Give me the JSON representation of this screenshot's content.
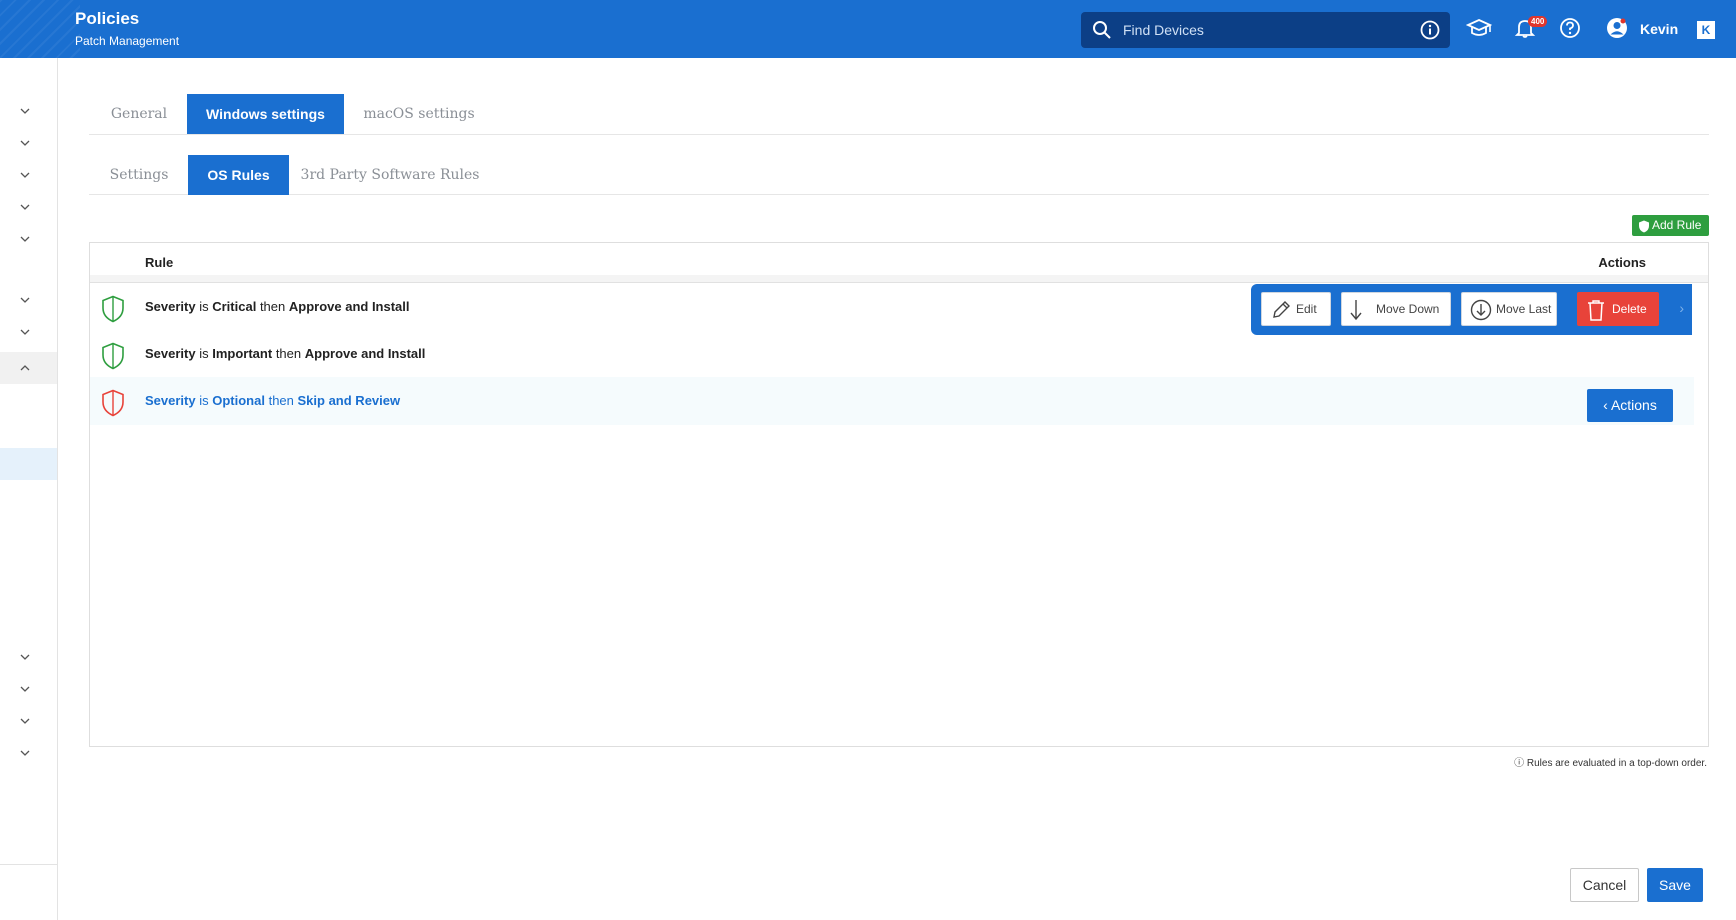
{
  "header": {
    "title": "Policies",
    "subtitle": "Patch Management",
    "search": {
      "placeholder": "Find Devices",
      "value": ""
    },
    "notification_count": "400",
    "user_name": "Kevin",
    "collapse_label": "K"
  },
  "tabs": [
    {
      "label": "General",
      "active": false
    },
    {
      "label": "Windows settings",
      "active": true
    },
    {
      "label": "macOS settings",
      "active": false
    }
  ],
  "subtabs": [
    {
      "label": "Settings",
      "active": false
    },
    {
      "label": "OS Rules",
      "active": true
    },
    {
      "label": "3rd Party Software Rules",
      "active": false
    }
  ],
  "add_rule_label": "Add Rule",
  "table": {
    "columns": {
      "rule": "Rule",
      "actions": "Actions"
    },
    "rows": [
      {
        "field": "Severity",
        "op": "is",
        "value": "Critical",
        "then": "then",
        "action": "Approve and Install",
        "status": "allow"
      },
      {
        "field": "Severity",
        "op": "is",
        "value": "Important",
        "then": "then",
        "action": "Approve and Install",
        "status": "allow"
      },
      {
        "field": "Severity",
        "op": "is",
        "value": "Optional",
        "then": "then",
        "action": "Skip and Review",
        "status": "deny"
      }
    ]
  },
  "row_toolbar": {
    "edit": "Edit",
    "move_down": "Move Down",
    "move_last": "Move Last",
    "delete": "Delete"
  },
  "actions_button": "Actions",
  "footer_note": "Rules are evaluated in a top-down order.",
  "footer": {
    "cancel": "Cancel",
    "save": "Save"
  },
  "colors": {
    "primary": "#1a6fd0",
    "success": "#2e9e3f",
    "danger": "#e8433a"
  }
}
